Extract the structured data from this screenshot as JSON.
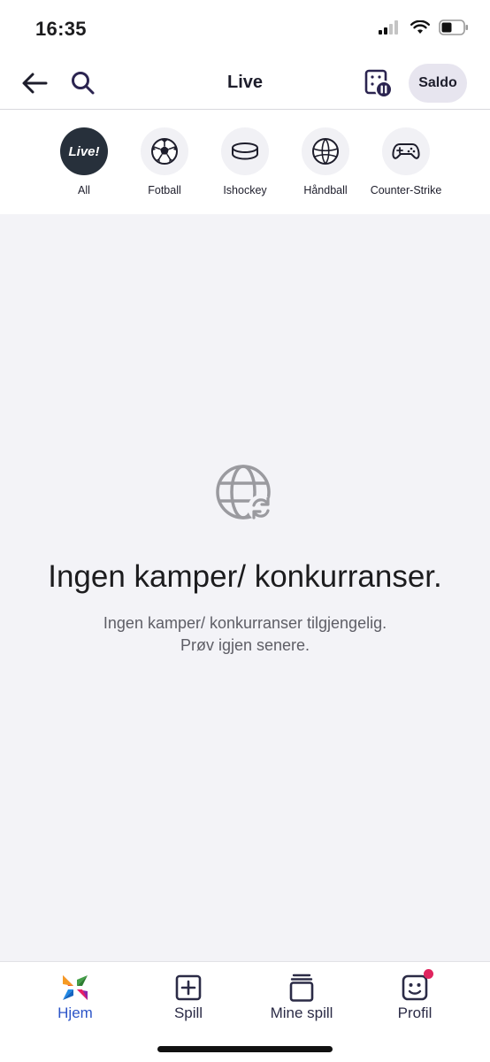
{
  "status_bar": {
    "time": "16:35"
  },
  "header": {
    "title": "Live",
    "saldo_label": "Saldo"
  },
  "categories": [
    {
      "label": "All",
      "badge": "Live!"
    },
    {
      "label": "Fotball"
    },
    {
      "label": "Ishockey"
    },
    {
      "label": "Håndball"
    },
    {
      "label": "Counter-Strike"
    }
  ],
  "empty_state": {
    "title": "Ingen kamper/ konkurranser.",
    "line1": "Ingen kamper/ konkurranser tilgjengelig.",
    "line2": "Prøv igjen senere."
  },
  "tabbar": [
    {
      "label": "Hjem"
    },
    {
      "label": "Spill"
    },
    {
      "label": "Mine spill"
    },
    {
      "label": "Profil"
    }
  ],
  "colors": {
    "accent": "#2c55c8",
    "active_category": "#27303b",
    "notification": "#e0245e",
    "background": "#f3f3f7"
  }
}
